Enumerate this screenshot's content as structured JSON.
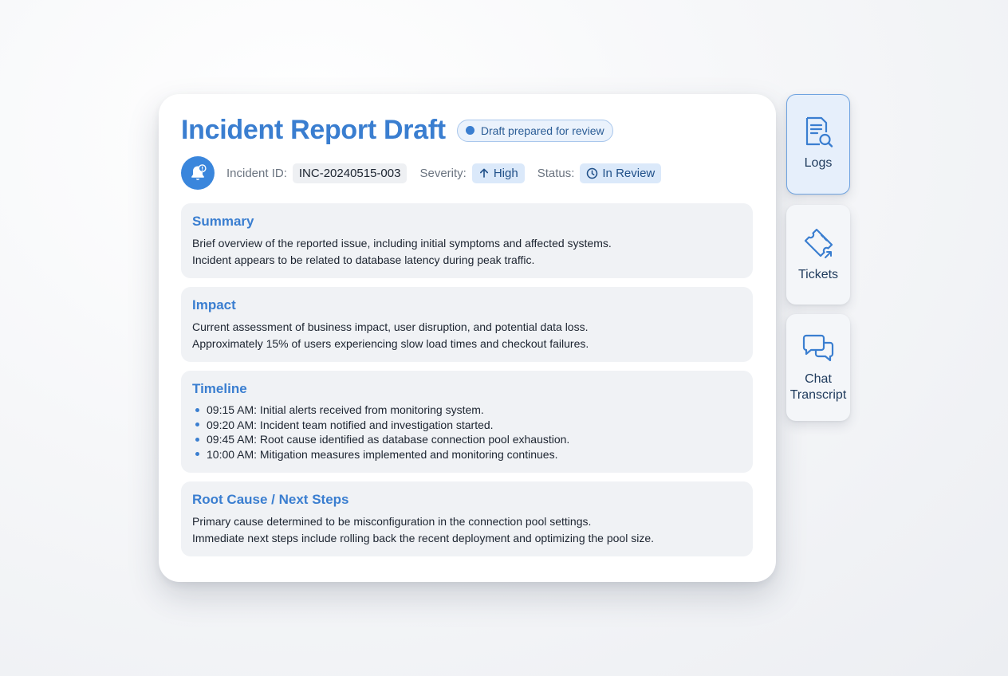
{
  "report": {
    "title": "Incident Report Draft",
    "draft_badge": "Draft prepared for review",
    "meta": {
      "incident_id_label": "Incident ID:",
      "incident_id_value": "INC-20240515-003",
      "severity_label": "Severity:",
      "severity_value": "High",
      "status_label": "Status:",
      "status_value": "In Review"
    }
  },
  "sections": {
    "summary": {
      "title": "Summary",
      "lines": [
        "Brief overview of the reported issue, including initial symptoms and affected systems.",
        "Incident appears to be related to database latency during peak traffic."
      ]
    },
    "impact": {
      "title": "Impact",
      "lines": [
        "Current assessment of business impact, user disruption, and potential data loss.",
        "Approximately 15% of users experiencing slow load times and checkout failures."
      ]
    },
    "timeline": {
      "title": "Timeline",
      "items": [
        "09:15 AM: Initial alerts received from monitoring system.",
        "09:20 AM: Incident team notified and investigation started.",
        "09:45 AM: Root cause identified as database connection pool exhaustion.",
        "10:00 AM: Mitigation measures implemented and monitoring continues."
      ]
    },
    "root_cause": {
      "title": "Root Cause / Next Steps",
      "lines": [
        "Primary cause determined to be misconfiguration in the connection pool settings.",
        "Immediate next steps include rolling back the recent deployment and optimizing the pool size."
      ]
    }
  },
  "side_panel": {
    "tabs": [
      {
        "label": "Logs",
        "icon": "document-search-icon",
        "active": true
      },
      {
        "label": "Tickets",
        "icon": "ticket-icon",
        "active": false
      },
      {
        "label_line1": "Chat",
        "label_line2": "Transcript",
        "icon": "chat-bubbles-icon",
        "active": false
      }
    ]
  },
  "colors": {
    "accent": "#3a7ed0",
    "chip_bg": "#dbe9fa",
    "section_bg": "#f0f2f5"
  }
}
